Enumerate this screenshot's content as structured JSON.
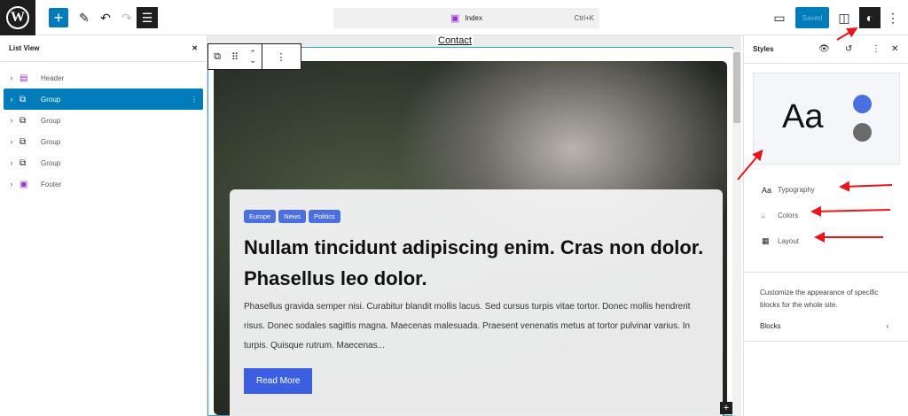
{
  "topbar": {
    "command_label": "Index",
    "shortcut": "Ctrl+K",
    "saved_label": "Saved"
  },
  "list_view": {
    "title": "List View",
    "items": [
      {
        "label": "Header"
      },
      {
        "label": "Group"
      },
      {
        "label": "Group"
      },
      {
        "label": "Group"
      },
      {
        "label": "Group"
      },
      {
        "label": "Footer"
      }
    ]
  },
  "canvas": {
    "nav_link": "Contact",
    "tags": [
      "Europe",
      "News",
      "Politics"
    ],
    "title": "Nullam tincidunt adipiscing enim. Cras non dolor. Phasellus leo dolor.",
    "excerpt": "Phasellus gravida semper nisi. Curabitur blandit mollis lacus. Sed cursus turpis vitae tortor. Donec mollis hendrerit risus. Donec sodales sagittis magna. Maecenas malesuada. Praesent venenatis metus at tortor pulvinar varius. In turpis. Quisque rutrum. Maecenas...",
    "read_more": "Read More"
  },
  "styles": {
    "title": "Styles",
    "preview_text": "Aa",
    "colors": [
      "#4a6fe0",
      "#6b6b6b"
    ],
    "menu": [
      {
        "label": "Typography",
        "icon": "Aa"
      },
      {
        "label": "Colors"
      },
      {
        "label": "Layout"
      }
    ],
    "description": "Customize the appearance of specific blocks for the whole site.",
    "blocks_label": "Blocks"
  },
  "accent": "#007cba"
}
